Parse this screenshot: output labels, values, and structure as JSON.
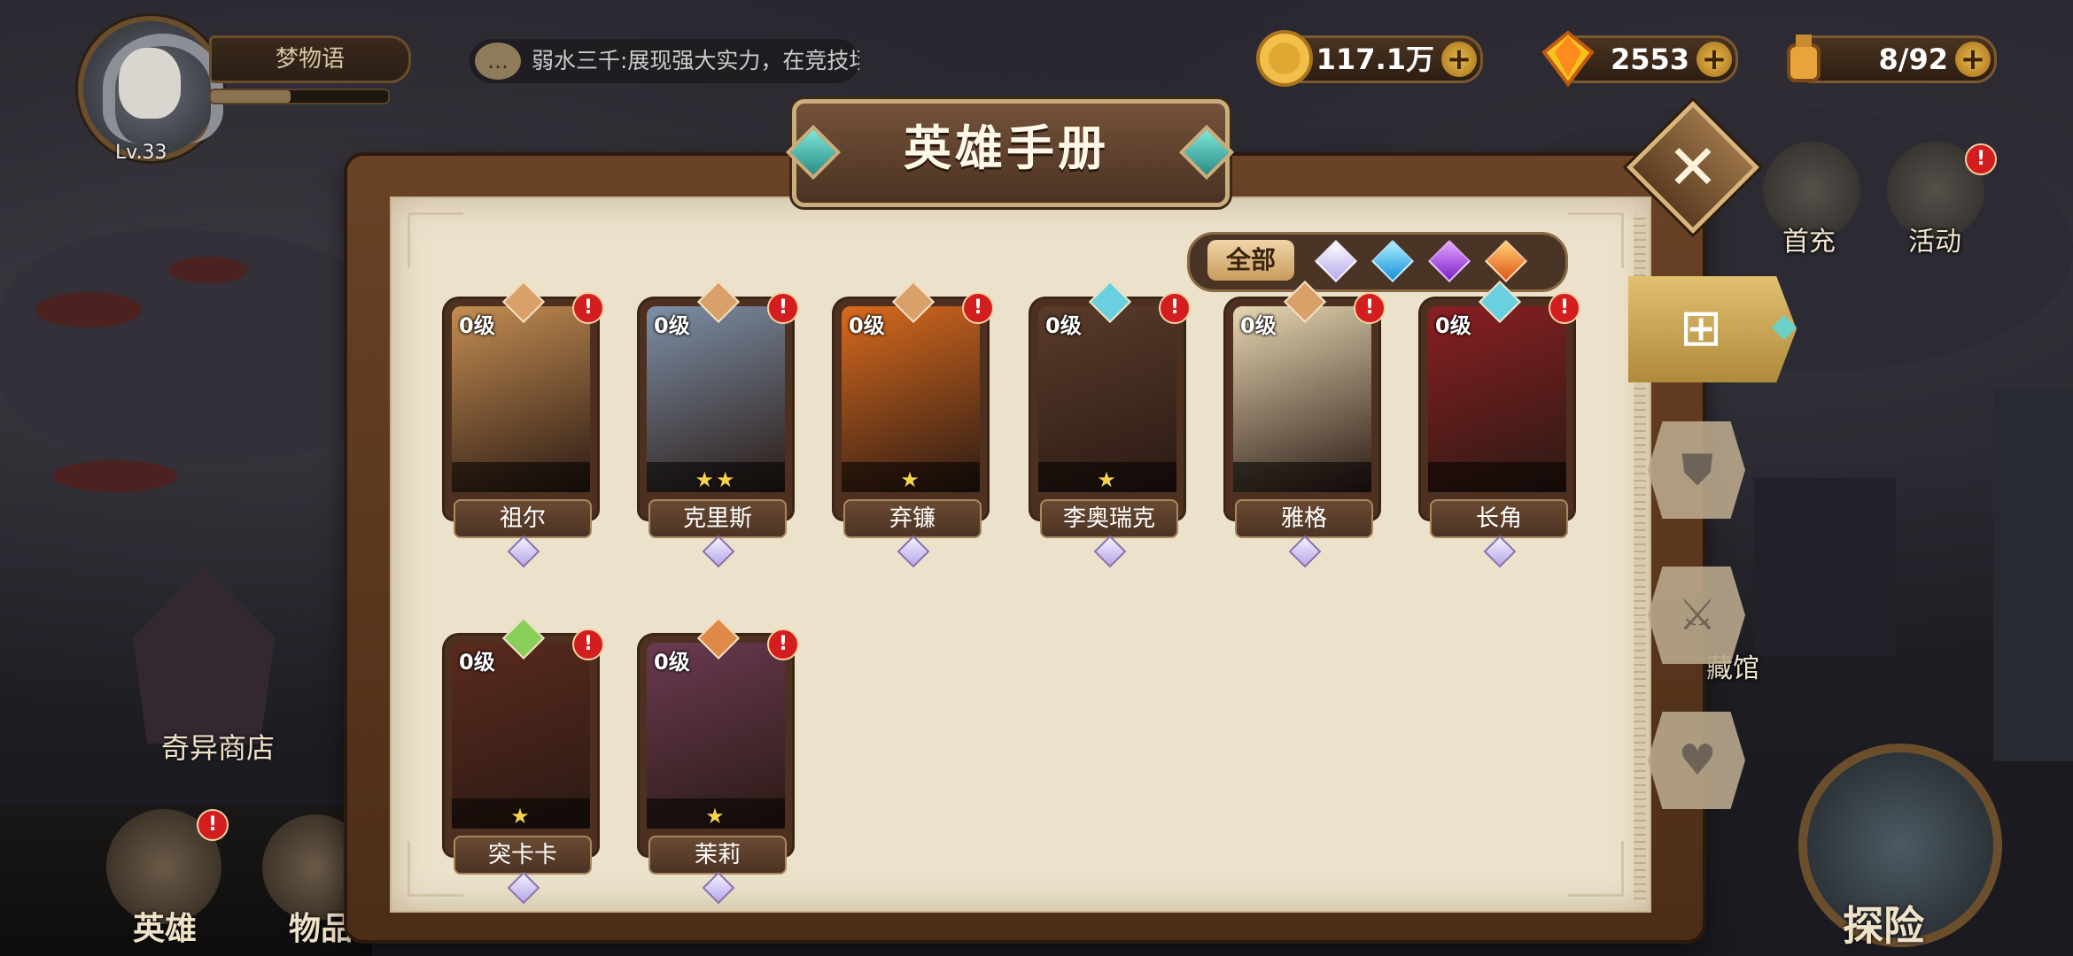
{
  "player": {
    "level": "Lv.33",
    "name": "梦物语",
    "exp_fraction": 0.45
  },
  "chat": {
    "message": "弱水三千:展现强大实力，在竞技场中"
  },
  "currencies": [
    {
      "name": "gold",
      "value": "117.1万"
    },
    {
      "name": "diamond",
      "value": "2553"
    },
    {
      "name": "stamina",
      "value": "8/92"
    }
  ],
  "side_menu": {
    "first_recharge": "首充",
    "events": "活动",
    "museum_partial": "藏馆"
  },
  "bottom": {
    "shop": "奇异商店",
    "heroes": "英雄",
    "items": "物品",
    "explore": "探险"
  },
  "book": {
    "title": "英雄手册",
    "close": "✕"
  },
  "filters": {
    "all_label": "全部"
  },
  "tabs": [
    {
      "id": "all-grid",
      "active": true
    },
    {
      "id": "tank"
    },
    {
      "id": "warrior"
    },
    {
      "id": "support"
    }
  ],
  "alert_symbol": "!",
  "heroes": [
    {
      "name": "祖尔",
      "level": "0级",
      "stars": "",
      "art": "#c48d52",
      "role": "#d9a06a"
    },
    {
      "name": "克里斯",
      "level": "0级",
      "stars": "★★",
      "art": "#7d8fa6",
      "role": "#d9a06a"
    },
    {
      "name": "弃镰",
      "level": "0级",
      "stars": "★",
      "art": "#d86a1e",
      "role": "#d9a06a"
    },
    {
      "name": "李奥瑞克",
      "level": "0级",
      "stars": "★",
      "art": "#5a3b2a",
      "role": "#6ad0e0"
    },
    {
      "name": "雅格",
      "level": "0级",
      "stars": "",
      "art": "#e6d6b2",
      "role": "#d9a06a"
    },
    {
      "name": "长角",
      "level": "0级",
      "stars": "",
      "art": "#8a1f22",
      "role": "#6ad0e0"
    },
    {
      "name": "突卡卡",
      "level": "0级",
      "stars": "★",
      "art": "#5a2a1e",
      "role": "#8acf5a"
    },
    {
      "name": "茉莉",
      "level": "0级",
      "stars": "★",
      "art": "#6a3a52",
      "role": "#e08a4a"
    }
  ]
}
